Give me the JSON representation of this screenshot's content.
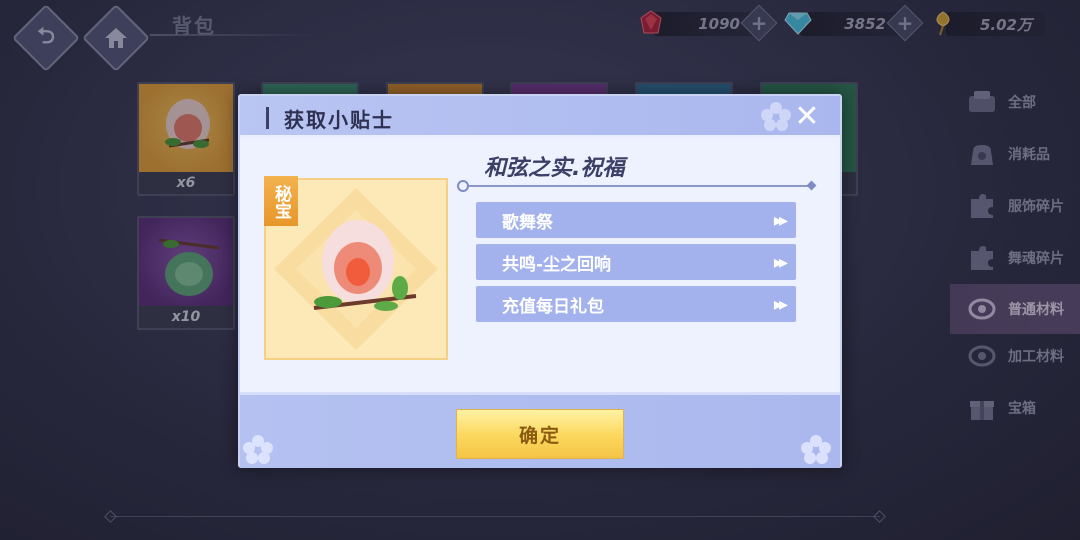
{
  "header": {
    "back_label": "",
    "title": "背包"
  },
  "currencies": [
    {
      "icon": "red-crystal-icon",
      "value": "1090",
      "color": "#c0243a"
    },
    {
      "icon": "diamond-icon",
      "value": "3852",
      "color": "#3fb9d9"
    },
    {
      "icon": "gold-leaf-icon",
      "value": "5.02万",
      "color": "#d8a93a"
    }
  ],
  "inventory": [
    {
      "qty": "x6",
      "bg": "#e6a23a"
    },
    {
      "qty": "",
      "bg": "#3c8f72"
    },
    {
      "qty": "",
      "bg": "#d68a2f"
    },
    {
      "qty": "",
      "bg": "#7a3c94"
    },
    {
      "qty": "",
      "bg": "#2f6f9a"
    },
    {
      "qty": "",
      "bg": "#2f7a5a"
    },
    {
      "qty": "x10",
      "bg": "#6c3d8c"
    }
  ],
  "sidebar": {
    "items": [
      {
        "label": "全部",
        "icon": "all-items-icon"
      },
      {
        "label": "消耗品",
        "icon": "consumable-bag-icon"
      },
      {
        "label": "服饰碎片",
        "icon": "puzzle-piece-icon"
      },
      {
        "label": "舞魂碎片",
        "icon": "puzzle-piece-icon"
      },
      {
        "label": "普通材料",
        "icon": "material-ring-icon"
      },
      {
        "label": "加工材料",
        "icon": "processed-material-icon"
      },
      {
        "label": "宝箱",
        "icon": "gift-box-icon"
      }
    ],
    "active_index": 4
  },
  "modal": {
    "title": "获取小贴士",
    "close_icon": "close-icon",
    "rarity_tag": "秘宝",
    "item_name": "和弦之实.祝福",
    "sources": [
      {
        "label": "歌舞祭"
      },
      {
        "label": "共鸣-尘之回响"
      },
      {
        "label": "充值每日礼包"
      }
    ],
    "confirm_label": "确定"
  },
  "colors": {
    "modal_bg": "#eef2ff",
    "modal_header": "#b9c5f2",
    "source_button": "#a3b2ec",
    "confirm_button": "#fbd75c",
    "rarity_tag": "#f3b24e",
    "sidebar_active": "#8c6ea0"
  }
}
